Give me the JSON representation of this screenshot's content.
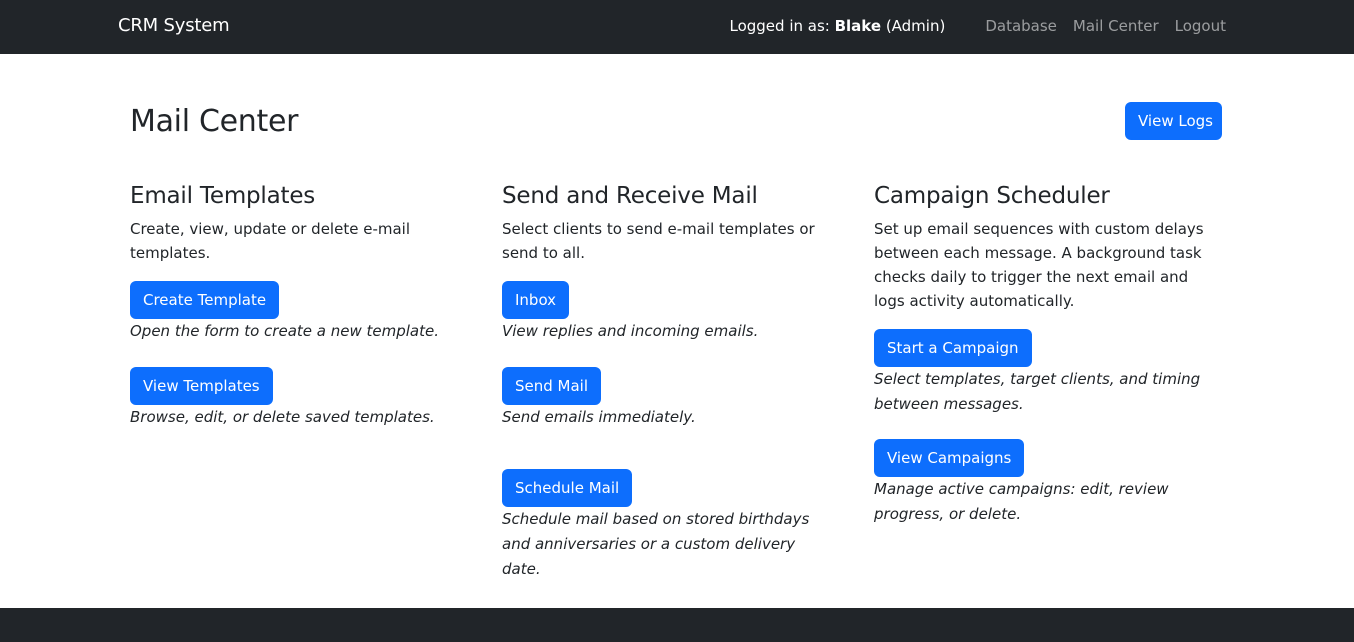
{
  "navbar": {
    "brand": "CRM System",
    "logged_prefix": "Logged in as: ",
    "user": "Blake",
    "role": " (Admin)",
    "links": [
      "Database",
      "Mail Center",
      "Logout"
    ]
  },
  "page": {
    "title": "Mail Center",
    "view_logs": "View Logs"
  },
  "columns": [
    {
      "heading": "Email Templates",
      "description": "Create, view, update or delete e-mail templates.",
      "actions": [
        {
          "label": "Create Template",
          "note": "Open the form to create a new template."
        },
        {
          "label": "View Templates",
          "note": "Browse, edit, or delete saved templates."
        }
      ]
    },
    {
      "heading": "Send and Receive Mail",
      "description": "Select clients to send e-mail templates or send to all.",
      "actions": [
        {
          "label": "Inbox",
          "note": "View replies and incoming emails."
        },
        {
          "label": "Send Mail",
          "note": "Send emails immediately."
        },
        {
          "label": "Schedule Mail",
          "note": "Schedule mail based on stored birthdays and anniversaries or a custom delivery date."
        }
      ]
    },
    {
      "heading": "Campaign Scheduler",
      "description": "Set up email sequences with custom delays between each message. A background task checks daily to trigger the next email and logs activity automatically.",
      "actions": [
        {
          "label": "Start a Campaign",
          "note": "Select templates, target clients, and timing between messages."
        },
        {
          "label": "View Campaigns",
          "note": "Manage active campaigns: edit, review progress, or delete."
        }
      ]
    }
  ],
  "colors": {
    "navbar_bg": "#212529",
    "primary": "#0d6efd",
    "text": "#212529"
  }
}
